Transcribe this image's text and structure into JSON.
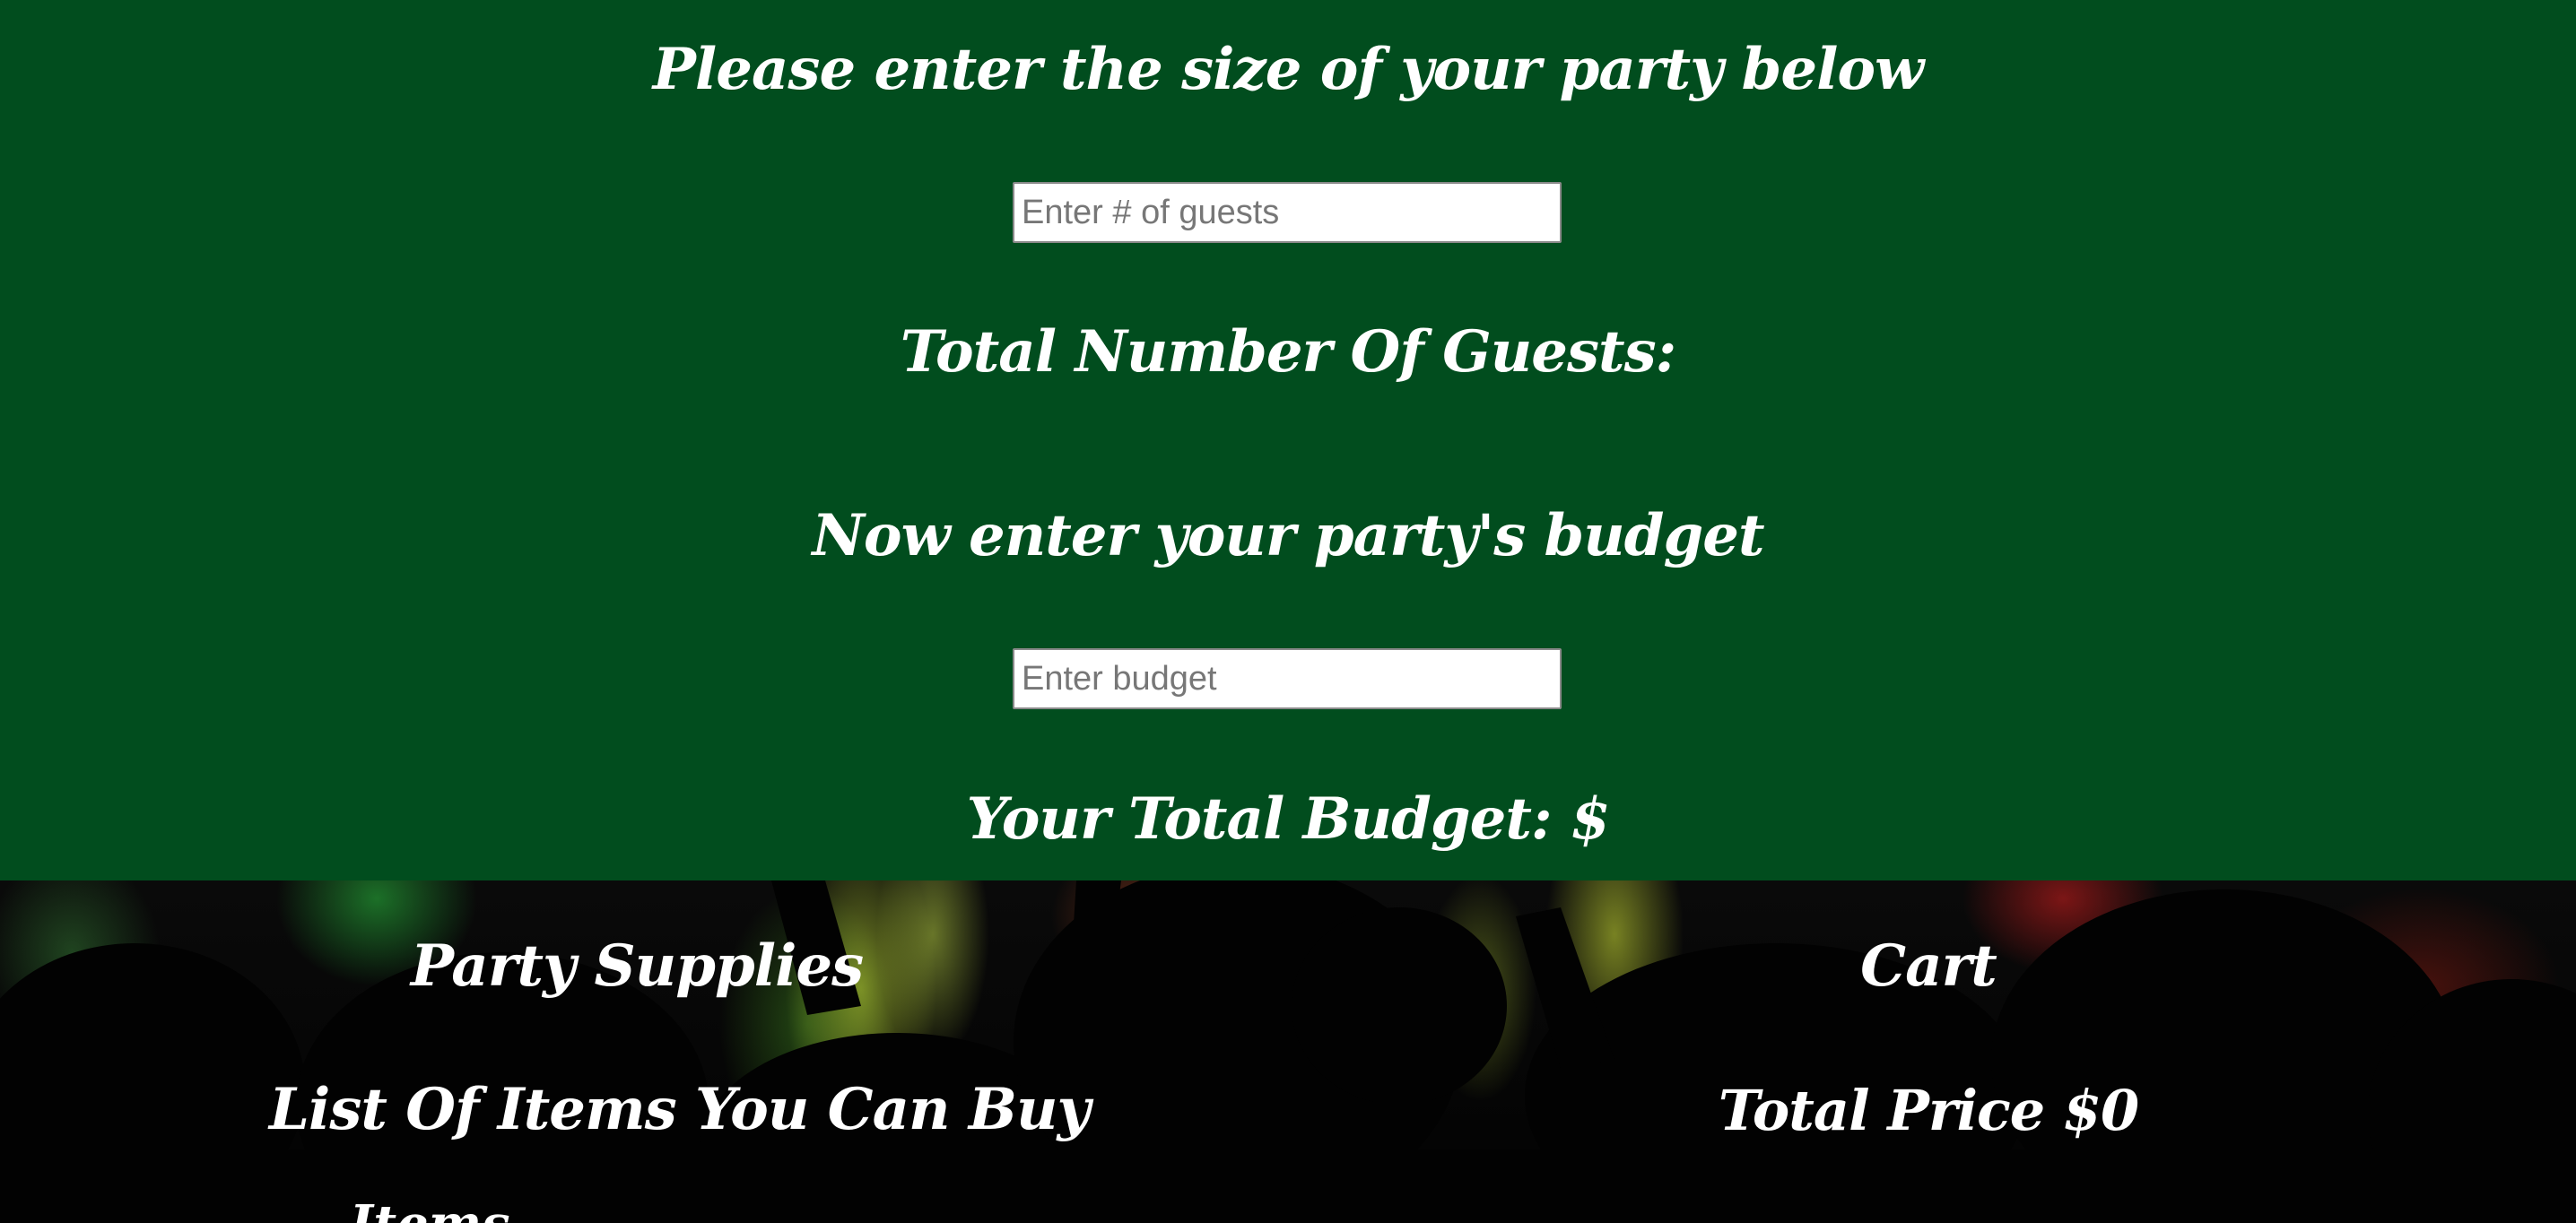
{
  "guests_section": {
    "heading": "Please enter the size of your party below",
    "input_placeholder": "Enter # of guests",
    "input_value": "",
    "total_label": "Total Number Of Guests:"
  },
  "budget_section": {
    "heading": "Now enter your party's budget",
    "input_placeholder": "Enter budget",
    "input_value": "",
    "total_label": "Your Total Budget: $"
  },
  "supplies": {
    "title": "Party Supplies",
    "list_title": "List Of Items You Can Buy",
    "first_item_partial": "Items"
  },
  "cart": {
    "title": "Cart",
    "total_price": "Total Price $0"
  },
  "colors": {
    "top_background": "#014d1e",
    "text": "#ffffff"
  }
}
